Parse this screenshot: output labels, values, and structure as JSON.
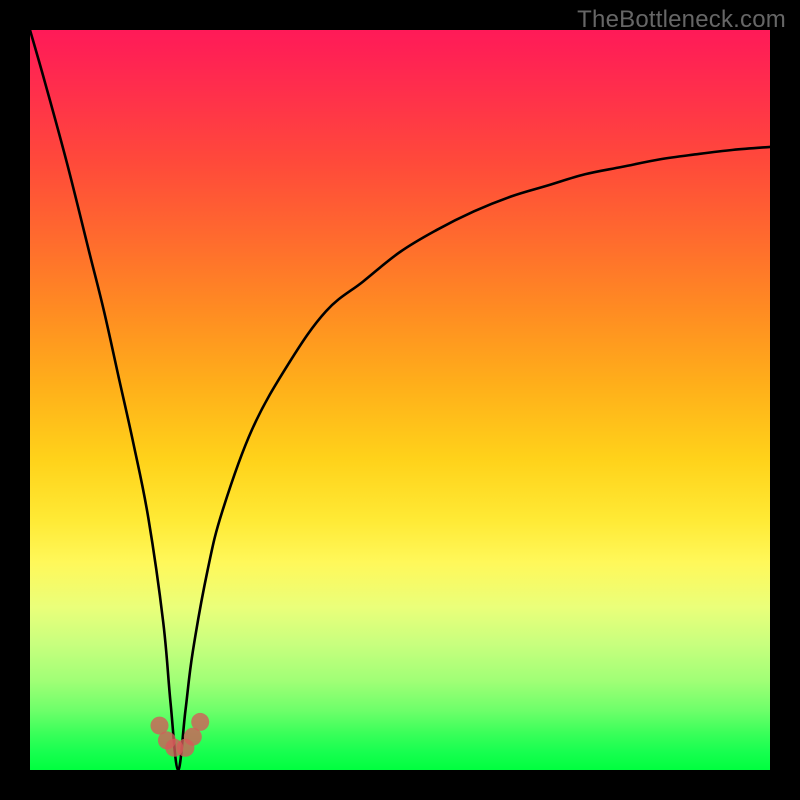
{
  "watermark": "TheBottleneck.com",
  "colors": {
    "background": "#000000",
    "curve": "#000000",
    "marker": "#d55a5a"
  },
  "chart_data": {
    "type": "line",
    "title": "",
    "xlabel": "",
    "ylabel": "",
    "xlim": [
      0,
      100
    ],
    "ylim": [
      0,
      100
    ],
    "grid": false,
    "legend": false,
    "note": "Curve valley (minimum) occurs at x ≈ 20 where y ≈ 0. Values approach ~100 at left edge and ~84 at right edge.",
    "series": [
      {
        "name": "bottleneck-curve",
        "x": [
          0,
          2,
          5,
          8,
          10,
          12,
          14,
          16,
          18,
          19,
          20,
          21,
          22,
          24,
          26,
          30,
          35,
          40,
          45,
          50,
          55,
          60,
          65,
          70,
          75,
          80,
          85,
          90,
          95,
          100
        ],
        "values": [
          100,
          93,
          82,
          70,
          62,
          53,
          44,
          34,
          20,
          9,
          0,
          8,
          16,
          27,
          35,
          46,
          55,
          62,
          66,
          70,
          73,
          75.5,
          77.5,
          79,
          80.5,
          81.5,
          82.5,
          83.2,
          83.8,
          84.2
        ]
      }
    ],
    "markers": {
      "name": "valley-dots",
      "x": [
        17.5,
        18.5,
        19.5,
        21.0,
        22.0,
        23.0
      ],
      "values": [
        6.0,
        4.0,
        3.0,
        3.0,
        4.5,
        6.5
      ]
    }
  }
}
